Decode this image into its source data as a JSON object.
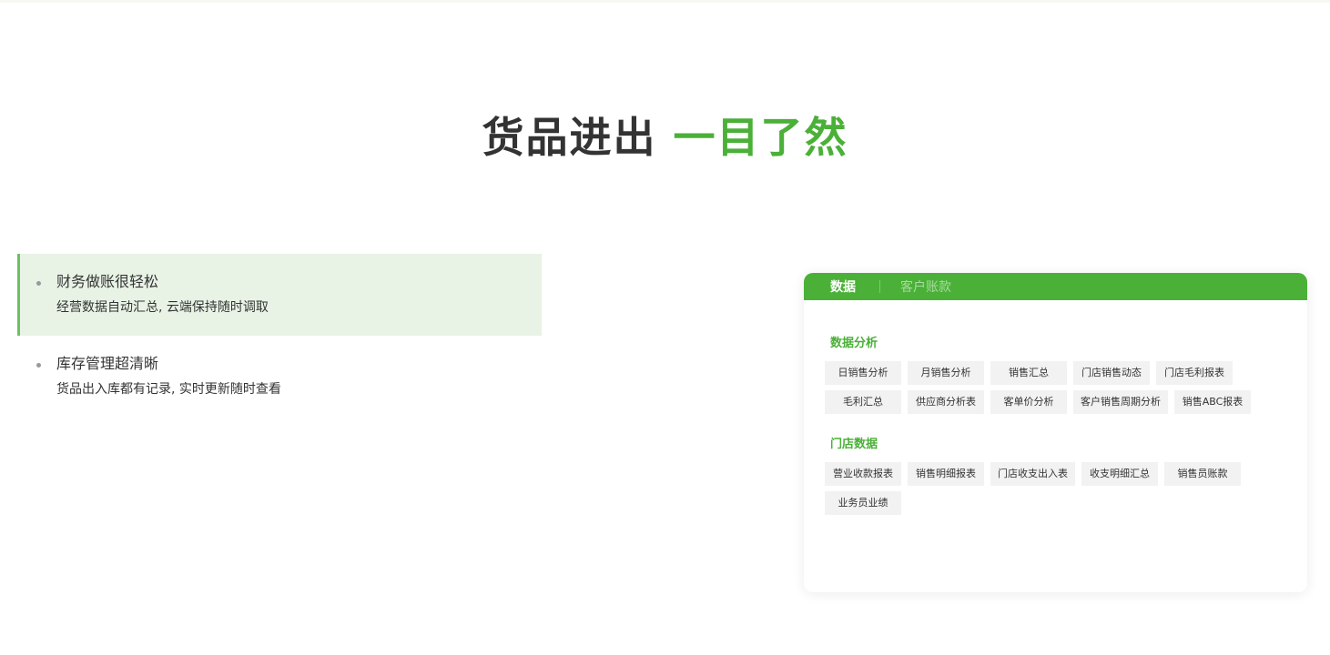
{
  "headline": {
    "dark": "货品进出",
    "green": "一目了然"
  },
  "features": [
    {
      "title": "财务做账很轻松",
      "desc": "经营数据自动汇总, 云端保持随时调取",
      "active": true
    },
    {
      "title": "库存管理超清晰",
      "desc": "货品出入库都有记录, 实时更新随时查看",
      "active": false
    }
  ],
  "card": {
    "tabs": [
      "数据",
      "客户账款"
    ],
    "sections": [
      {
        "title": "数据分析",
        "tags": [
          "日销售分析",
          "月销售分析",
          "销售汇总",
          "门店销售动态",
          "门店毛利报表",
          "毛利汇总",
          "供应商分析表",
          "客单价分析",
          "客户销售周期分析",
          "销售ABC报表"
        ]
      },
      {
        "title": "门店数据",
        "tags": [
          "营业收款报表",
          "销售明细报表",
          "门店收支出入表",
          "收支明细汇总",
          "销售员账款",
          "业务员业绩"
        ]
      }
    ]
  },
  "colors": {
    "brand_green": "#4bb038",
    "active_bg": "#e8f3e6",
    "tag_bg": "#f2f2f2"
  }
}
